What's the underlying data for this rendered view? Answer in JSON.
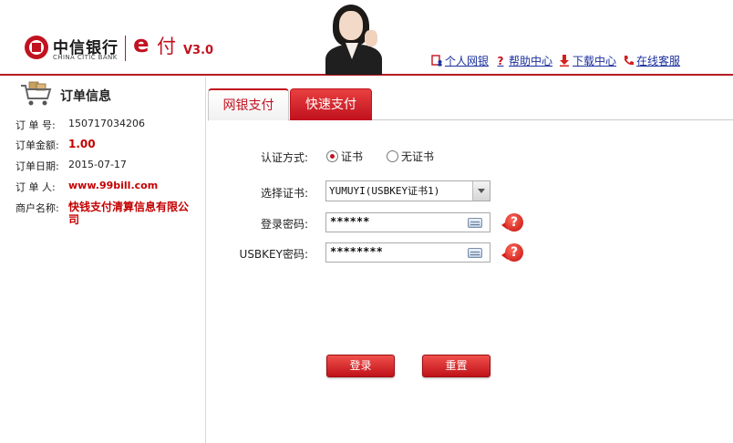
{
  "header": {
    "bank_name_cn": "中信银行",
    "bank_name_en": "CHINA CITIC BANK",
    "product_letter": "e",
    "product_name": "付",
    "version": "V3.0",
    "links": [
      {
        "label": "个人网银",
        "icon": "person-icon"
      },
      {
        "label": "帮助中心",
        "icon": "question-icon"
      },
      {
        "label": "下载中心",
        "icon": "download-arrow-icon"
      },
      {
        "label": "在线客服",
        "icon": "phone-icon"
      }
    ]
  },
  "sidebar": {
    "title": "订单信息",
    "order_no_label": "订 单 号:",
    "order_no": "150717034206",
    "amount_label": "订单金额:",
    "amount": "1.00",
    "date_label": "订单日期:",
    "date": "2015-07-17",
    "orderer_label": "订 单 人:",
    "orderer": "www.99bill.com",
    "merchant_label": "商户名称:",
    "merchant": "快钱支付清算信息有限公司"
  },
  "tabs": [
    {
      "label": "网银支付",
      "active": true
    },
    {
      "label": "快速支付",
      "active": false
    }
  ],
  "form": {
    "auth_label": "认证方式:",
    "auth_options": [
      {
        "label": "证书",
        "selected": true
      },
      {
        "label": "无证书",
        "selected": false
      }
    ],
    "cert_label": "选择证书:",
    "cert_value": "YUMUYI(USBKEY证书1)",
    "login_pwd_label": "登录密码:",
    "login_pwd_value": "******",
    "usbkey_pwd_label": "USBKEY密码:",
    "usbkey_pwd_value": "********",
    "login_button": "登录",
    "reset_button": "重置"
  },
  "colors": {
    "brand_red": "#c1121f",
    "link_blue": "#1a2f9c"
  }
}
